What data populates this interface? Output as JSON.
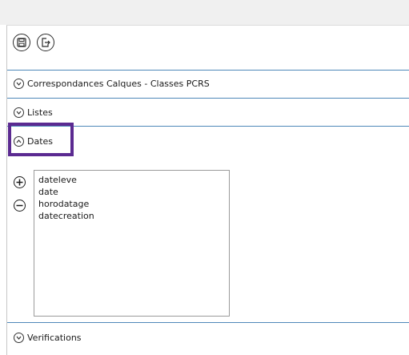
{
  "toolbar": {
    "save_icon": "save-icon",
    "export_icon": "export-icon"
  },
  "sections": {
    "correspondances": {
      "label": "Correspondances Calques - Classes PCRS",
      "state": "collapsed"
    },
    "listes": {
      "label": "Listes",
      "state": "collapsed"
    },
    "dates": {
      "label": "Dates",
      "state": "expanded",
      "highlighted": true
    },
    "verifications": {
      "label": "Verifications",
      "state": "collapsed"
    }
  },
  "dates_list": {
    "add_icon": "plus-icon",
    "remove_icon": "minus-icon",
    "items": [
      "dateleve",
      "date",
      "horodatage",
      "datecreation"
    ]
  },
  "colors": {
    "separator": "#4f88b9",
    "highlight": "#5b2a91",
    "topbar": "#f0f0f0"
  }
}
